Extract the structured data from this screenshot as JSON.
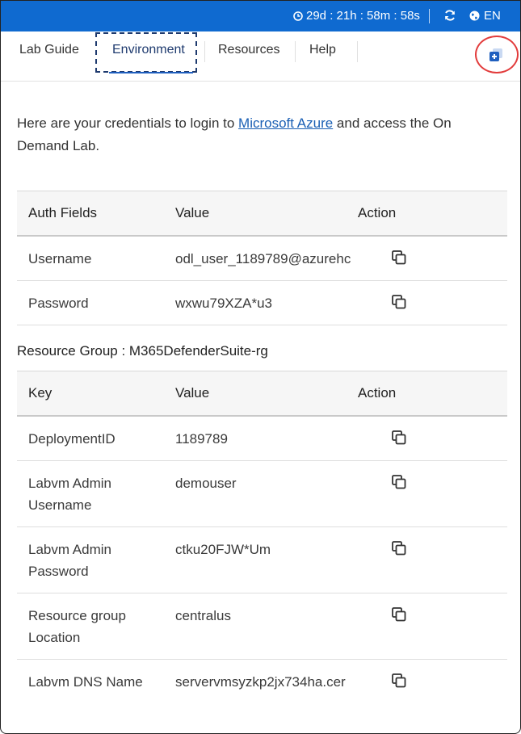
{
  "topbar": {
    "timer": "29d : 21h : 58m : 58s",
    "language": "EN",
    "colors": {
      "background": "#0f6ad0"
    }
  },
  "tabs": [
    {
      "label": "Lab Guide",
      "active": false
    },
    {
      "label": "Environment",
      "active": true
    },
    {
      "label": "Resources",
      "active": false
    },
    {
      "label": "Help",
      "active": false
    }
  ],
  "intro": {
    "before_link": "Here are your credentials to login to ",
    "link": "Microsoft Azure",
    "after_link": " and access the On Demand Lab."
  },
  "auth_table": {
    "headers": [
      "Auth Fields",
      "Value",
      "Action"
    ],
    "rows": [
      {
        "field": "Username",
        "value": "odl_user_1189789@azurehc"
      },
      {
        "field": "Password",
        "value": "wxwu79XZA*u3"
      }
    ]
  },
  "resource_group": {
    "title": "Resource Group : M365DefenderSuite-rg",
    "headers": [
      "Key",
      "Value",
      "Action"
    ],
    "rows": [
      {
        "key": "DeploymentID",
        "value": "1189789"
      },
      {
        "key": "Labvm Admin Username",
        "value": "demouser"
      },
      {
        "key": "Labvm Admin Password",
        "value": "ctku20FJW*Um"
      },
      {
        "key": "Resource group Location",
        "value": "centralus"
      },
      {
        "key": "Labvm DNS Name",
        "value": "servervmsyzkp2jx734ha.cer"
      }
    ]
  },
  "icons": {
    "timer": "clock-icon",
    "refresh": "refresh-icon",
    "language": "globe-icon",
    "popout": "popout-window-icon",
    "copy": "copy-icon"
  }
}
